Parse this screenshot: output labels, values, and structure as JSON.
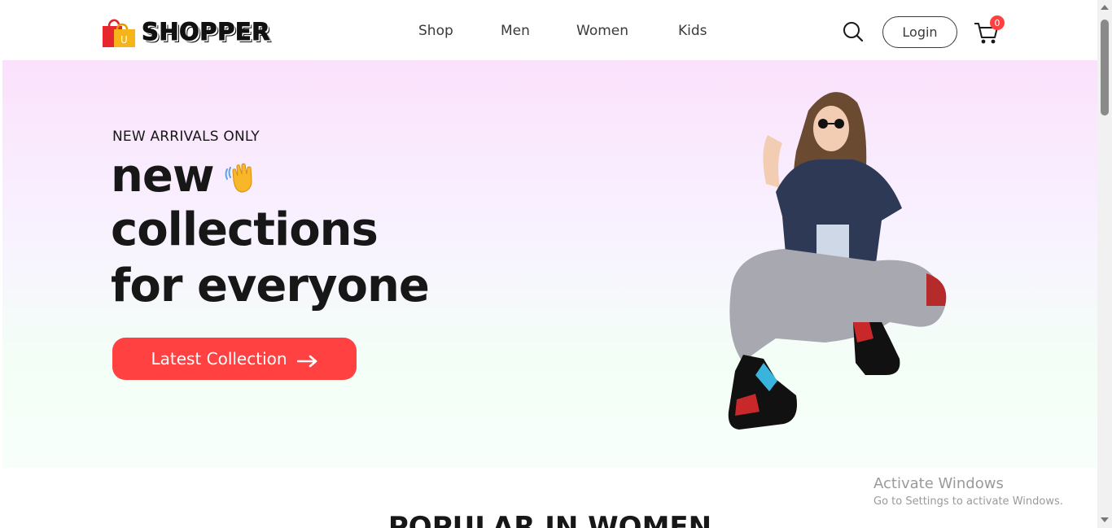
{
  "navbar": {
    "brand": "SHOPPER",
    "logo_icon": "shopping-bag-icon",
    "menu": [
      {
        "label": "Shop"
      },
      {
        "label": "Men"
      },
      {
        "label": "Women"
      },
      {
        "label": "Kids"
      }
    ],
    "search_icon": "search-icon",
    "login_label": "Login",
    "cart_icon": "cart-icon",
    "cart_count": "0"
  },
  "hero": {
    "subtitle": "NEW ARRIVALS ONLY",
    "line1": "new",
    "line2": "collections",
    "line3": "for everyone",
    "hand_icon": "waving-hand-icon",
    "button_label": "Latest Collection",
    "button_icon": "arrow-right-icon",
    "accent_color": "#ff4141"
  },
  "section": {
    "popular_title": "POPULAR IN WOMEN"
  },
  "windows_watermark": {
    "title": "Activate Windows",
    "subtitle": "Go to Settings to activate Windows."
  }
}
